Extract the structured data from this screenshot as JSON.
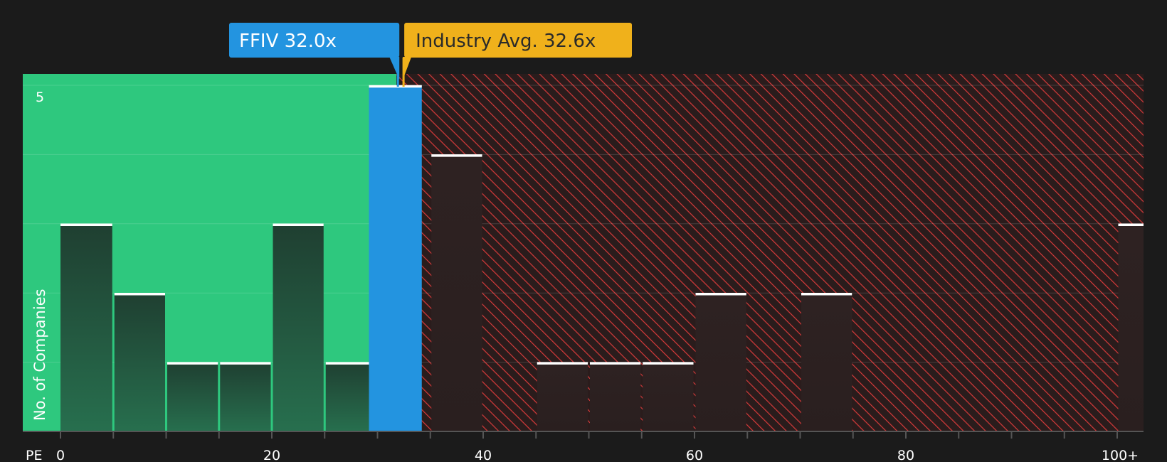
{
  "colors": {
    "background": "#1b1b1b",
    "undervalued_zone": "#2ec87e",
    "overvalued_hatch": "#d63a3a",
    "company_bar": "#2394e0",
    "industry_avg": "#f0b11b",
    "bar_top_line": "#ffffff"
  },
  "callouts": {
    "company": {
      "label": "FFIV 32.0x",
      "value": 32.0
    },
    "industry": {
      "label": "Industry Avg. 32.6x",
      "value": 32.6
    }
  },
  "chart_data": {
    "type": "bar",
    "title": "",
    "xlabel": "PE",
    "ylabel": "No. of Companies",
    "bin_width": 5,
    "x_range": [
      0,
      102.5
    ],
    "ylim": [
      0,
      5
    ],
    "y_ticks": [
      {
        "value": 5,
        "label": "5"
      }
    ],
    "x_ticks": [
      {
        "value": 0,
        "label": "0"
      },
      {
        "value": 20,
        "label": "20"
      },
      {
        "value": 40,
        "label": "40"
      },
      {
        "value": 60,
        "label": "60"
      },
      {
        "value": 80,
        "label": "80"
      },
      {
        "value": 100,
        "label": "100+"
      }
    ],
    "x_minor_ticks": [
      0,
      5,
      10,
      15,
      20,
      25,
      30,
      35,
      40,
      45,
      50,
      55,
      60,
      65,
      70,
      75,
      80,
      85,
      90,
      95,
      100
    ],
    "undervalued_below": 32.6,
    "highlight_bin": 30,
    "bins": [
      {
        "x": 0,
        "count": 3
      },
      {
        "x": 5,
        "count": 2
      },
      {
        "x": 10,
        "count": 1
      },
      {
        "x": 15,
        "count": 1
      },
      {
        "x": 20,
        "count": 3
      },
      {
        "x": 25,
        "count": 1
      },
      {
        "x": 30,
        "count": 5
      },
      {
        "x": 35,
        "count": 4
      },
      {
        "x": 40,
        "count": 0
      },
      {
        "x": 45,
        "count": 1
      },
      {
        "x": 50,
        "count": 1
      },
      {
        "x": 55,
        "count": 1
      },
      {
        "x": 60,
        "count": 2
      },
      {
        "x": 65,
        "count": 0
      },
      {
        "x": 70,
        "count": 2
      },
      {
        "x": 75,
        "count": 0
      },
      {
        "x": 80,
        "count": 0
      },
      {
        "x": 85,
        "count": 0
      },
      {
        "x": 90,
        "count": 0
      },
      {
        "x": 95,
        "count": 0
      },
      {
        "x": 100,
        "count": 3
      }
    ]
  }
}
